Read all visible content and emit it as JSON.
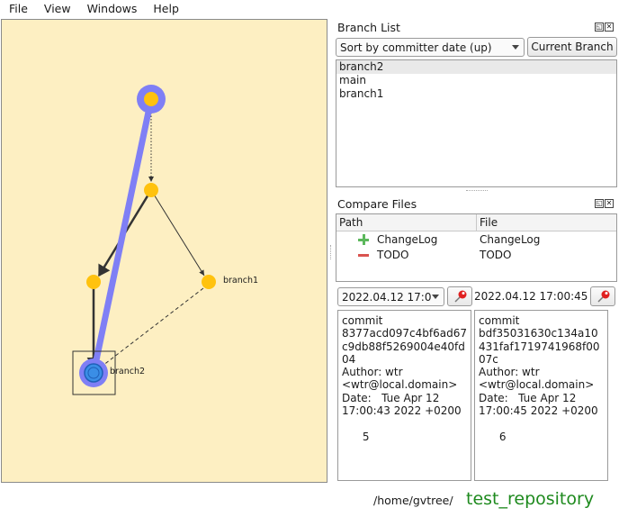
{
  "menu": [
    "File",
    "View",
    "Windows",
    "Help"
  ],
  "graph": {
    "labels": {
      "branch1": "branch1",
      "branch2": "branch2"
    },
    "colors": {
      "background": "#fdefc2",
      "node": "#ffc20e",
      "highlight": "#7f7ff5",
      "head": "#3a8ee6"
    }
  },
  "branch_list": {
    "title": "Branch List",
    "sort_value": "Sort by committer date (up)",
    "current_branch_label": "Current Branch",
    "items": [
      "branch2",
      "main",
      "branch1"
    ]
  },
  "compare_files": {
    "title": "Compare Files",
    "columns": {
      "path": "Path",
      "file": "File"
    },
    "rows": [
      {
        "status": "added",
        "path": "ChangeLog",
        "file": "ChangeLog"
      },
      {
        "status": "removed",
        "path": "TODO",
        "file": "TODO"
      }
    ],
    "left_date": "2022.04.12 17:0",
    "right_date": "2022.04.12 17:00:45",
    "left_commit": "commit\n8377acd097c4bf6ad67c9db88f5269004e40fd04\nAuthor: wtr\n<wtr@local.domain>\nDate:   Tue Apr 12\n17:00:43 2022 +0200\n\n      5",
    "right_commit": "commit\nbdf35031630c134a10431faf1719741968f0007c\nAuthor: wtr\n<wtr@local.domain>\nDate:   Tue Apr 12\n17:00:45 2022 +0200\n\n      6"
  },
  "status": {
    "path": "/home/gvtree/",
    "repository": "test_repository"
  },
  "dock_icons": [
    "float-icon",
    "close-icon"
  ]
}
